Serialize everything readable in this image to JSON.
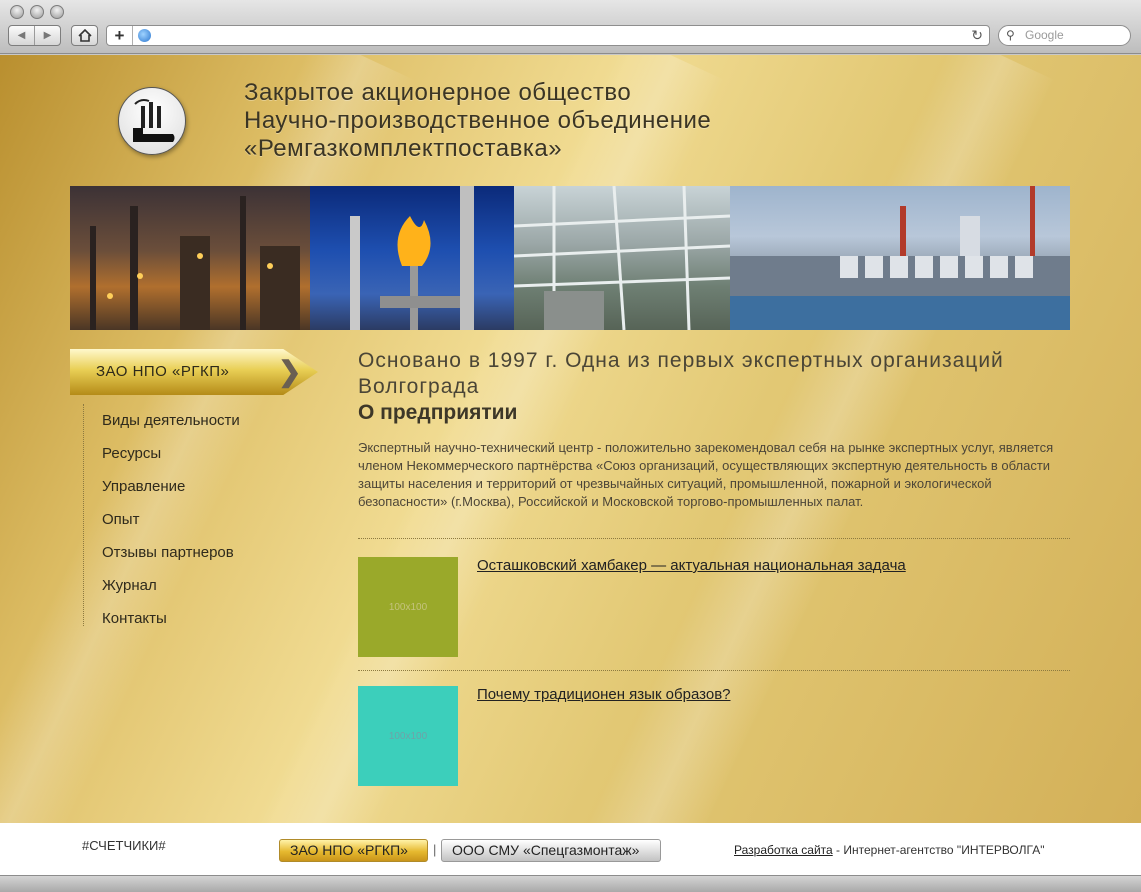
{
  "browser": {
    "search_placeholder": "Google"
  },
  "header": {
    "company_lines": [
      "Закрытое акционерное общество",
      "Научно-производственное объединение",
      "«Ремгазкомплектпоставка»"
    ]
  },
  "sidebar": {
    "title": "ЗАО НПО «РГКП»",
    "items": [
      {
        "label": "Виды деятельности"
      },
      {
        "label": "Ресурсы"
      },
      {
        "label": "Управление"
      },
      {
        "label": "Опыт"
      },
      {
        "label": "Отзывы партнеров"
      },
      {
        "label": "Журнал"
      },
      {
        "label": "Контакты"
      }
    ]
  },
  "main": {
    "headline": "Основано в 1997 г. Одна из первых экспертных организаций Волгограда",
    "subheading": "О предприятии",
    "description": "Экспертный научно-технический центр - положительно зарекомендовал себя на рынке экспертных услуг, является членом Некоммерческого партнёрства «Союз организаций, осуществляющих экспертную деятельность в области защиты населения и территорий от чрезвычайных ситуаций, промышленной, пожарной и экологической безопасности» (г.Москва), Российской и Московской торгово-промышленных палат.",
    "articles": [
      {
        "title": "Осташковский хамбакер — актуальная национальная задача",
        "thumb_color": "#9aa92a",
        "thumb_text": "100x100"
      },
      {
        "title": "Почему традиционен язык образов?",
        "thumb_color": "#3ccfbb",
        "thumb_text": "100x100"
      }
    ]
  },
  "footer": {
    "counters": "#СЧЕТЧИКИ#",
    "button_main": "ЗАО НПО «РГКП»",
    "divider": "|",
    "button_secondary": "ООО СМУ «Спецгазмонтаж»",
    "credit_link": "Разработка сайта",
    "credit_text": " - Интернет-агентство \"ИНТЕРВОЛГА\""
  },
  "colors": {
    "page_gold": "#dcbc63",
    "menu_gold": "#e9cf55"
  }
}
